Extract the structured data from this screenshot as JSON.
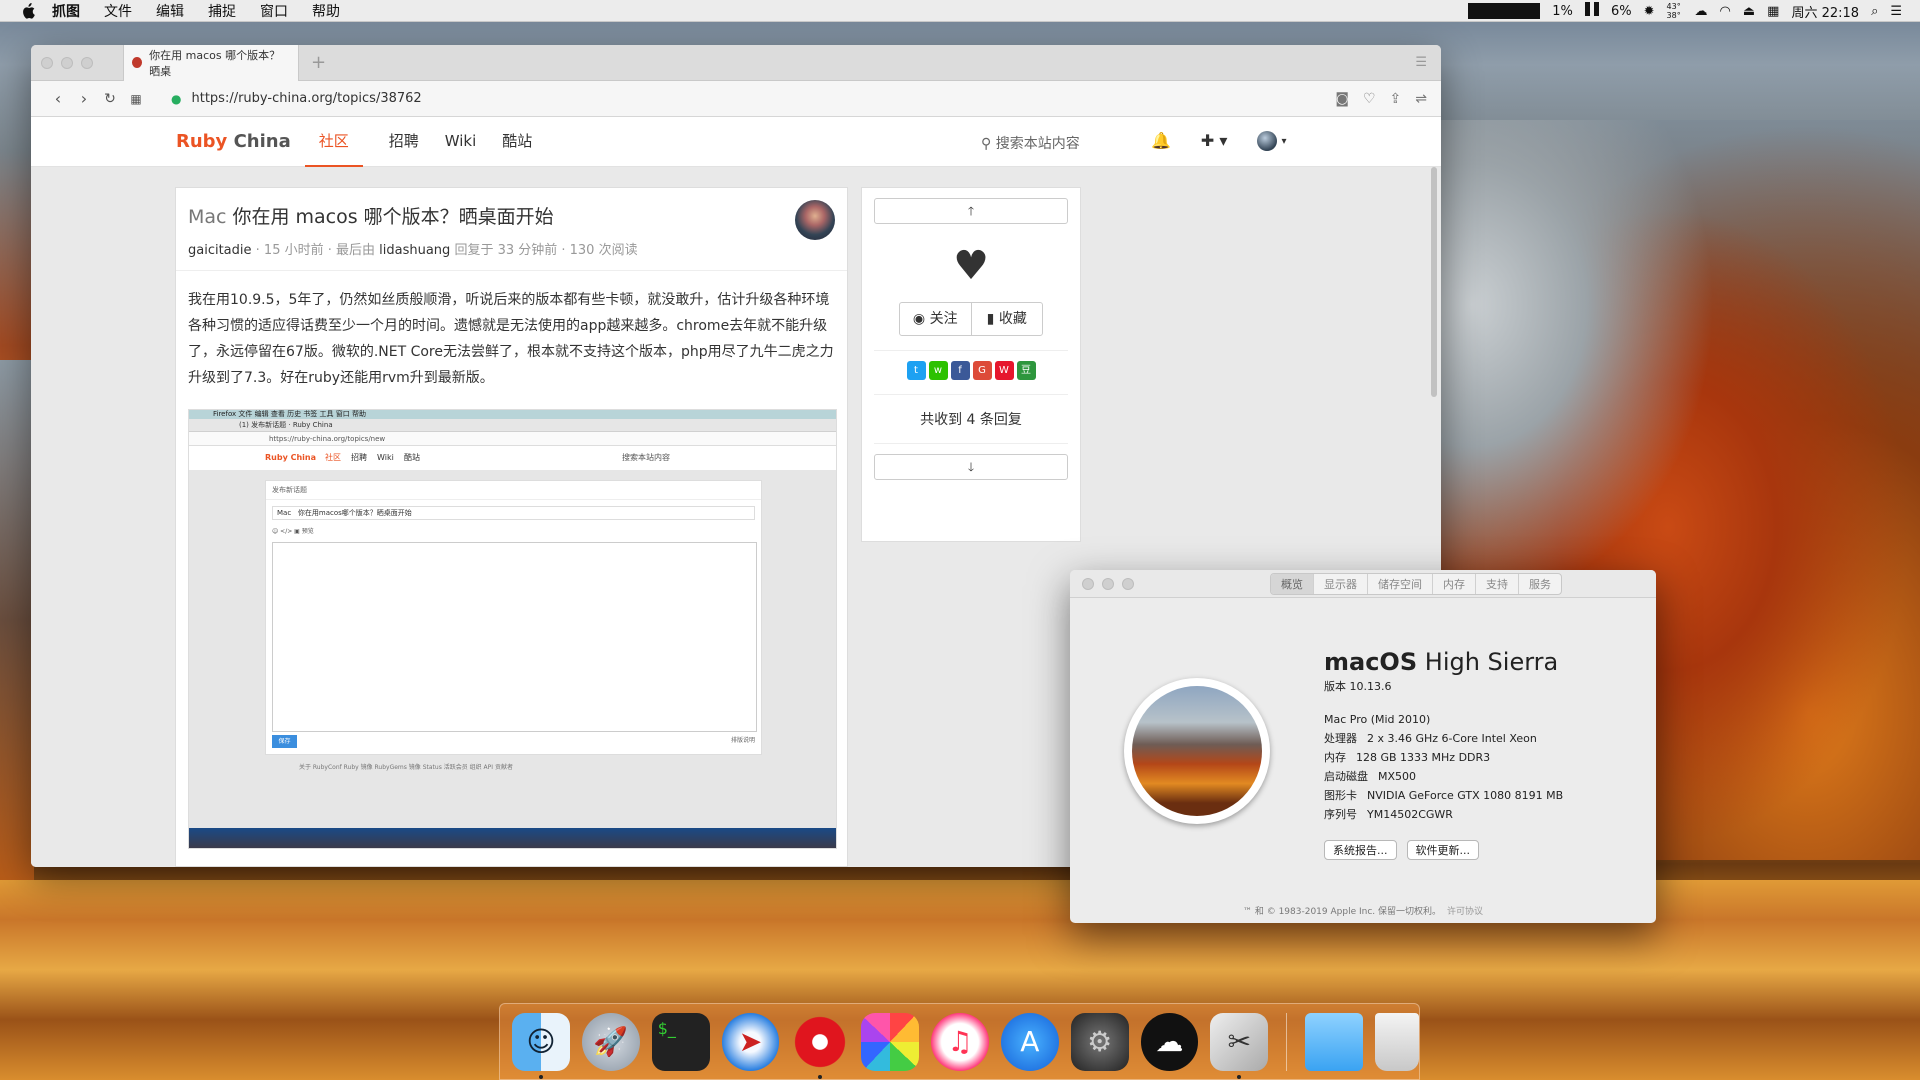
{
  "menubar": {
    "app": "抓图",
    "items": [
      "文件",
      "编辑",
      "捕捉",
      "窗口",
      "帮助"
    ],
    "status": {
      "cpu": "1%",
      "battery": "6%",
      "temp": "43° 38°",
      "clock": "周六 22:18"
    }
  },
  "browser": {
    "tab_title": "你在用 macos 哪个版本？晒桌",
    "url": "https://ruby-china.org/topics/38762",
    "site": {
      "brand_a": "Ruby",
      "brand_b": "China",
      "nav": [
        "社区",
        "招聘",
        "Wiki",
        "酷站"
      ],
      "search_placeholder": "搜索本站内容"
    },
    "topic": {
      "node": "Mac",
      "title": "你在用 macos 哪个版本？晒桌面开始",
      "author": "gaicitadie",
      "time": "· 15 小时前 · 最后由",
      "last_replier": "lidashuang",
      "replied": "回复于 33 分钟前 · 130 次阅读",
      "body": "我在用10.9.5，5年了，仍然如丝质般顺滑，听说后来的版本都有些卡顿，就没敢升，估计升级各种环境各种习惯的适应得话费至少一个月的时间。遗憾就是无法使用的app越来越多。chrome去年就不能升级了，永远停留在67版。微软的.NET Core无法尝鲜了，根本就不支持这个版本，php用尽了九牛二虎之力升级到了7.3。好在ruby还能用rvm升到最新版。",
      "screenshot": {
        "menu": "Firefox   文件   编辑   查看   历史   书签   工具   窗口   帮助",
        "tab": "(1) 发布新话题 · Ruby China",
        "url": "https://ruby-china.org/topics/new",
        "brand": "Ruby China",
        "nav": [
          "社区",
          "招聘",
          "Wiki",
          "酷站"
        ],
        "search": "搜索本站内容",
        "form_head": "发布新话题",
        "node": "Mac",
        "title_value": "你在用macos哪个版本？晒桌面开始",
        "tools": "☺  </>  ▣  预览",
        "save": "保存",
        "help": "排版说明",
        "footer": "关于   RubyConf   Ruby 镜像   RubyGems 镜像   Status   活跃会员   组织   API   贡献者"
      }
    },
    "sidebar": {
      "follow": "关注",
      "favorite": "收藏",
      "replies": "共收到 4 条回复"
    }
  },
  "about": {
    "tabs": [
      "概览",
      "显示器",
      "储存空间",
      "内存",
      "支持",
      "服务"
    ],
    "os_bold": "macOS",
    "os_rest": "High Sierra",
    "version": "版本 10.13.6",
    "model": "Mac Pro (Mid 2010)",
    "specs": [
      {
        "k": "处理器",
        "v": "2 x 3.46 GHz 6-Core Intel Xeon"
      },
      {
        "k": "内存",
        "v": "128 GB 1333 MHz DDR3"
      },
      {
        "k": "启动磁盘",
        "v": "MX500"
      },
      {
        "k": "图形卡",
        "v": "NVIDIA GeForce GTX 1080 8191 MB"
      },
      {
        "k": "序列号",
        "v": "YM14502CGWR"
      }
    ],
    "btn_report": "系统报告...",
    "btn_update": "软件更新...",
    "copyright": "™ 和 © 1983-2019 Apple Inc. 保留一切权利。",
    "license": "许可协议"
  },
  "dock": [
    "finder-icon",
    "launchpad-icon",
    "terminal-icon",
    "safari-icon",
    "opera-icon",
    "photos-icon",
    "itunes-icon",
    "app-store-icon",
    "system-preferences-icon",
    "cloud-app-icon",
    "screenshot-tool-icon",
    "folder-icon",
    "trash-icon"
  ]
}
